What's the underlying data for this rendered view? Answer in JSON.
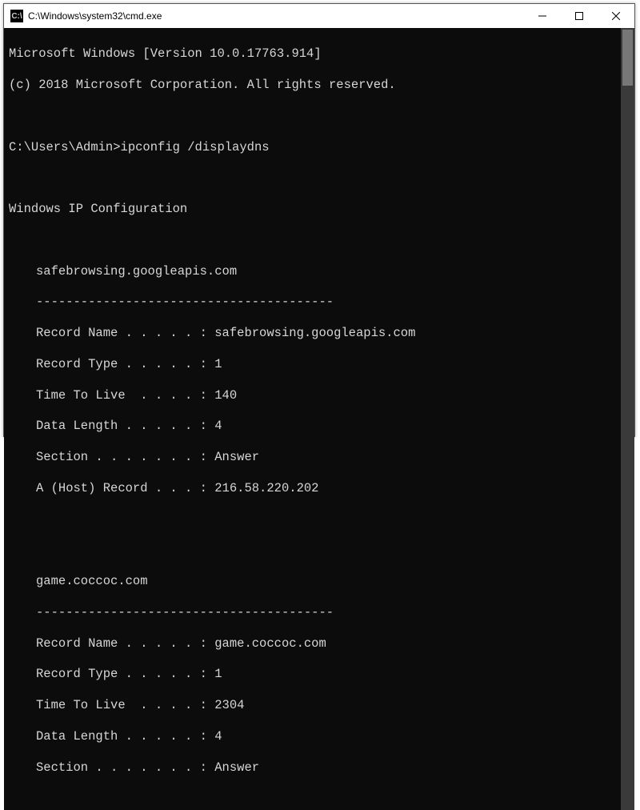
{
  "window": {
    "title": "C:\\Windows\\system32\\cmd.exe",
    "icon_label": "C:\\"
  },
  "banner": {
    "line1": "Microsoft Windows [Version 10.0.17763.914]",
    "line2": "(c) 2018 Microsoft Corporation. All rights reserved."
  },
  "prompt": {
    "text": "C:\\Users\\Admin>ipconfig /displaydns"
  },
  "heading": "Windows IP Configuration",
  "separator": "----------------------------------------",
  "labels": {
    "record_name": "Record Name . . . . . :",
    "record_type": "Record Type . . . . . :",
    "ttl": "Time To Live  . . . . :",
    "data_len": "Data Length . . . . . :",
    "section": "Section . . . . . . . :",
    "a_host": "A (Host) Record . . . :"
  },
  "entries": [
    {
      "host": "safebrowsing.googleapis.com",
      "record_name": "safebrowsing.googleapis.com",
      "record_type": "1",
      "ttl": "140",
      "data_len": "4",
      "section": "Answer",
      "a_host": "216.58.220.202"
    },
    {
      "host": "game.coccoc.com",
      "record_name": "game.coccoc.com",
      "record_type": "1",
      "ttl": "2304",
      "data_len": "4",
      "section": "Answer"
    }
  ]
}
